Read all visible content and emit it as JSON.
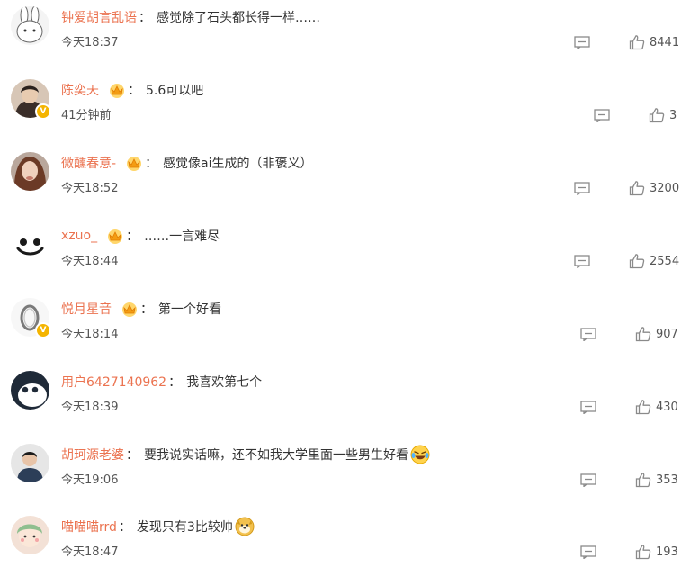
{
  "comments": [
    {
      "username": "钟爱胡言乱语",
      "separator": "：",
      "text": "感觉除了石头都长得一样……",
      "time": "今天18:37",
      "likes": "8441"
    },
    {
      "username": "陈奕天",
      "separator": "：",
      "text": "5.6可以吧",
      "time": "41分钟前",
      "likes": "3"
    },
    {
      "username": "微醺春意-",
      "separator": "：",
      "text": "感觉像ai生成的（非褒义）",
      "time": "今天18:52",
      "likes": "3200"
    },
    {
      "username": "xzuo_",
      "separator": "：",
      "text": "……一言难尽",
      "time": "今天18:44",
      "likes": "2554"
    },
    {
      "username": "悦月星音",
      "separator": "：",
      "text": "第一个好看",
      "time": "今天18:14",
      "likes": "907"
    },
    {
      "username": "用户6427140962",
      "separator": "：",
      "text": "我喜欢第七个",
      "time": "今天18:39",
      "likes": "430"
    },
    {
      "username": "胡珂源老婆",
      "separator": "：",
      "text": "要我说实话嘛，还不如我大学里面一些男生好看",
      "time": "今天19:06",
      "likes": "353"
    },
    {
      "username": "喵喵喵rrd",
      "separator": "：",
      "text": "发现只有3比较帅",
      "time": "今天18:47",
      "likes": "193"
    }
  ],
  "colors": {
    "username": "#eb7350",
    "text": "#333333",
    "meta": "#555555",
    "icon": "#8a8a8a"
  }
}
